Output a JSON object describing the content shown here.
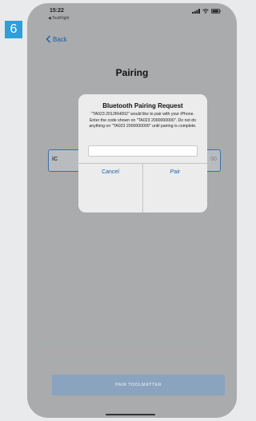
{
  "step_badge": "6",
  "status_bar": {
    "time": "15:22",
    "time_arrow": "⌁",
    "subtitle": "◀ TestFlight"
  },
  "nav": {
    "back_label": "Back"
  },
  "page": {
    "title": "Pairing"
  },
  "background_field": {
    "left_text": "iC",
    "right_text": "00"
  },
  "dialog": {
    "title": "Bluetooth Pairing Request",
    "message": "\"TA023 2012RH002\" would like to pair with your iPhone. Enter the code shown on \"TA023 2000000000\". Do not do anything on \"TA023 2000000000\" until pairing is complete.",
    "input_value": "",
    "cancel_label": "Cancel",
    "pair_label": "Pair"
  },
  "bottom_button": {
    "label": "PAIR TOOLMATTER"
  },
  "colors": {
    "badge": "#2f9fda",
    "accent": "#1c5ea8",
    "screen_dim": "#a9abad"
  }
}
